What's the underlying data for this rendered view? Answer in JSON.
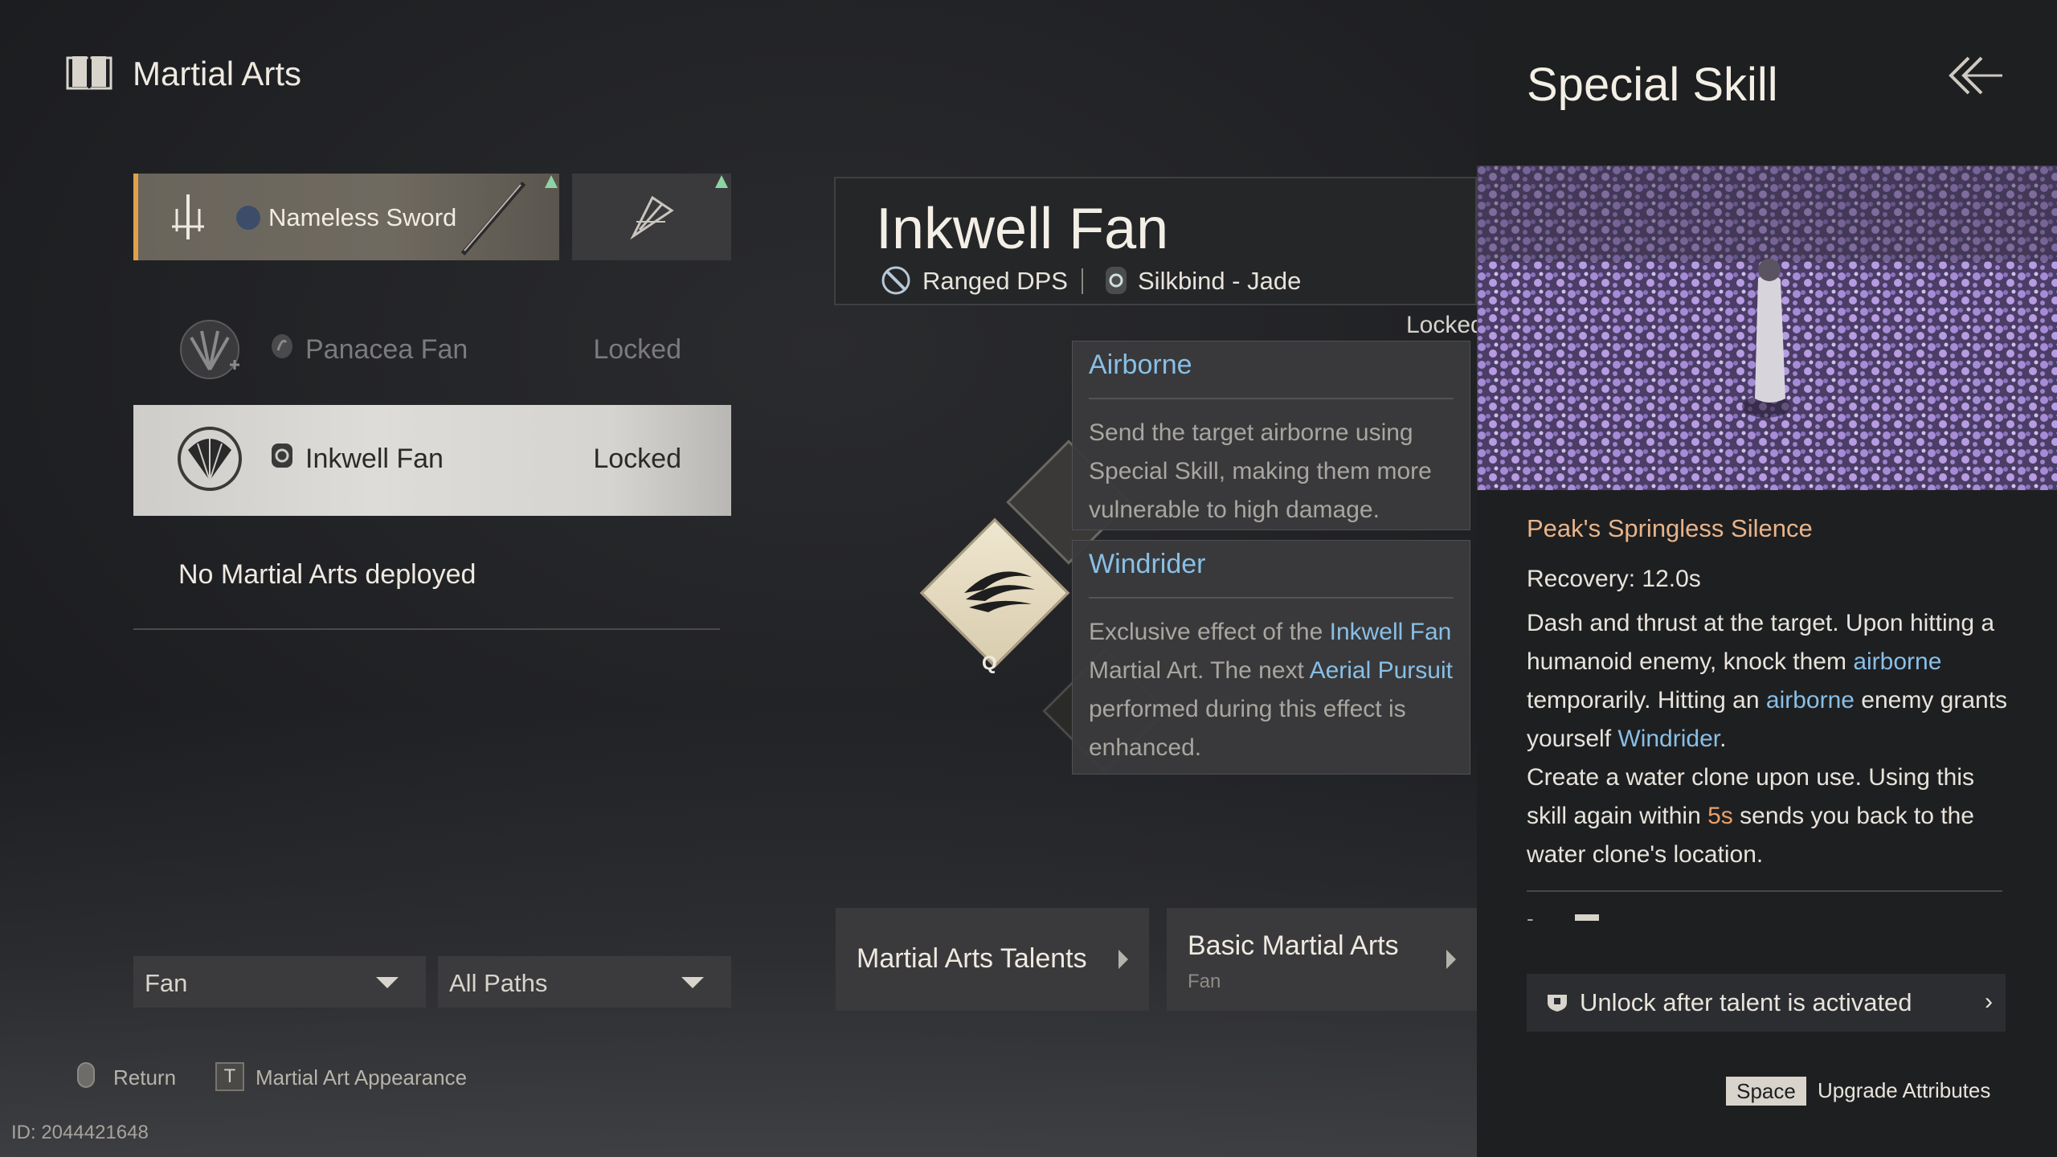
{
  "header": {
    "title": "Martial Arts",
    "icon": "book-icon"
  },
  "slots": {
    "active": {
      "label": "Nameless Sword",
      "icon": "sword-weapon-icon"
    },
    "alternate": {
      "icon": "fan-weapon-icon"
    },
    "upgrade_indicator_color": "#8ed3a4"
  },
  "arts_list": [
    {
      "name": "Panacea Fan",
      "status": "Locked"
    },
    {
      "name": "Inkwell Fan",
      "status": "Locked"
    }
  ],
  "empty_text": "No Martial Arts deployed",
  "filters": {
    "weapon": "Fan",
    "path": "All Paths"
  },
  "hints": {
    "return": "Return",
    "appearance_key": "T",
    "appearance": "Martial Art Appearance"
  },
  "id_text": "ID: 2044421648",
  "detail": {
    "name": "Inkwell Fan",
    "role": "Ranged DPS",
    "path": "Silkbind - Jade",
    "locked_label": "Locked",
    "skill_key": "Q"
  },
  "tooltips": {
    "airborne": {
      "title": "Airborne",
      "body": "Send the target airborne using Special Skill, making them more vulnerable to high damage."
    },
    "windrider": {
      "title": "Windrider",
      "body_part1": "Exclusive effect of the ",
      "body_hl1": "Inkwell Fan",
      "body_part2": " Martial Art. The next ",
      "body_hl2": "Aerial Pursuit",
      "body_part3": " performed during this effect is enhanced."
    }
  },
  "buttons": {
    "talents": "Martial Arts Talents",
    "basic": "Basic Martial Arts",
    "basic_sub": "Fan"
  },
  "special_skill": {
    "panel_title": "Special Skill",
    "skill_name": "Peak's Springless Silence",
    "recovery": "Recovery: 12.0s",
    "desc_1": "Dash and thrust at the target. Upon hitting a humanoid enemy, knock them ",
    "desc_hl_1": "airborne",
    "desc_2": " temporarily. Hitting an ",
    "desc_hl_2": "airborne",
    "desc_3": " enemy grants yourself ",
    "desc_hl_3": "Windrider",
    "desc_4": ".",
    "desc_5": "Create a water clone upon use. Using this skill again within ",
    "desc_hl_4": "5s",
    "desc_6": " sends you back to the water clone's location.",
    "dash": "-",
    "unlock": "Unlock after talent is activated",
    "unlock_arrow": "›",
    "space_key": "Space",
    "space_action": "Upgrade Attributes"
  },
  "colors": {
    "accent_orange": "#e0a14a",
    "highlight_blue": "#89bfe6",
    "skill_name": "#e8b48a"
  }
}
